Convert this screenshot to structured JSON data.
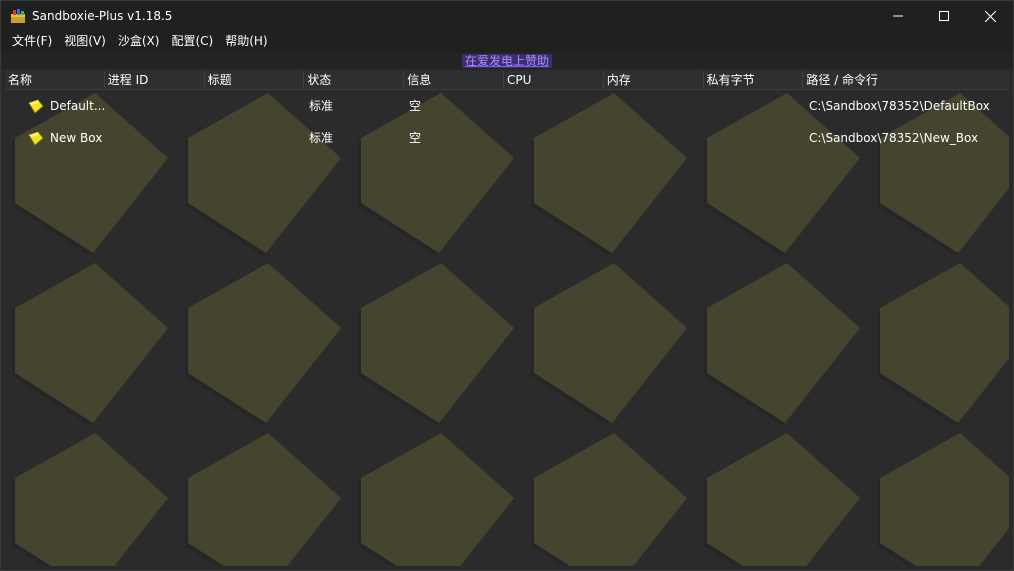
{
  "window": {
    "title": "Sandboxie-Plus v1.18.5",
    "minimize_symbol": "─",
    "maximize_symbol": "☐",
    "close_symbol": "✕"
  },
  "menu": {
    "items": [
      {
        "label": "文件(F)"
      },
      {
        "label": "视图(V)"
      },
      {
        "label": "沙盒(X)"
      },
      {
        "label": "配置(C)"
      },
      {
        "label": "帮助(H)"
      }
    ]
  },
  "donate": {
    "label": "在爱发电上赞助"
  },
  "columns": [
    {
      "label": "名称"
    },
    {
      "label": "进程 ID"
    },
    {
      "label": "标题"
    },
    {
      "label": "状态"
    },
    {
      "label": "信息"
    },
    {
      "label": "CPU"
    },
    {
      "label": "内存"
    },
    {
      "label": "私有字节"
    },
    {
      "label": "路径 / 命令行"
    }
  ],
  "boxes": [
    {
      "name": "Default...",
      "pid": "",
      "title": "",
      "status": "标准",
      "info": "空",
      "cpu": "",
      "memory": "",
      "private_bytes": "",
      "path": "C:\\Sandbox\\78352\\DefaultBox"
    },
    {
      "name": "New Box",
      "pid": "",
      "title": "",
      "status": "标准",
      "info": "空",
      "cpu": "",
      "memory": "",
      "private_bytes": "",
      "path": "C:\\Sandbox\\78352\\New_Box"
    }
  ],
  "colors": {
    "background": "#2b2b2b",
    "pattern_tile": "#45442f",
    "box_icon": "#f5e41a",
    "donate_text": "#b48cff"
  },
  "icons": {
    "app": "sandboxie-app-icon",
    "box": "yellow-box-icon"
  }
}
